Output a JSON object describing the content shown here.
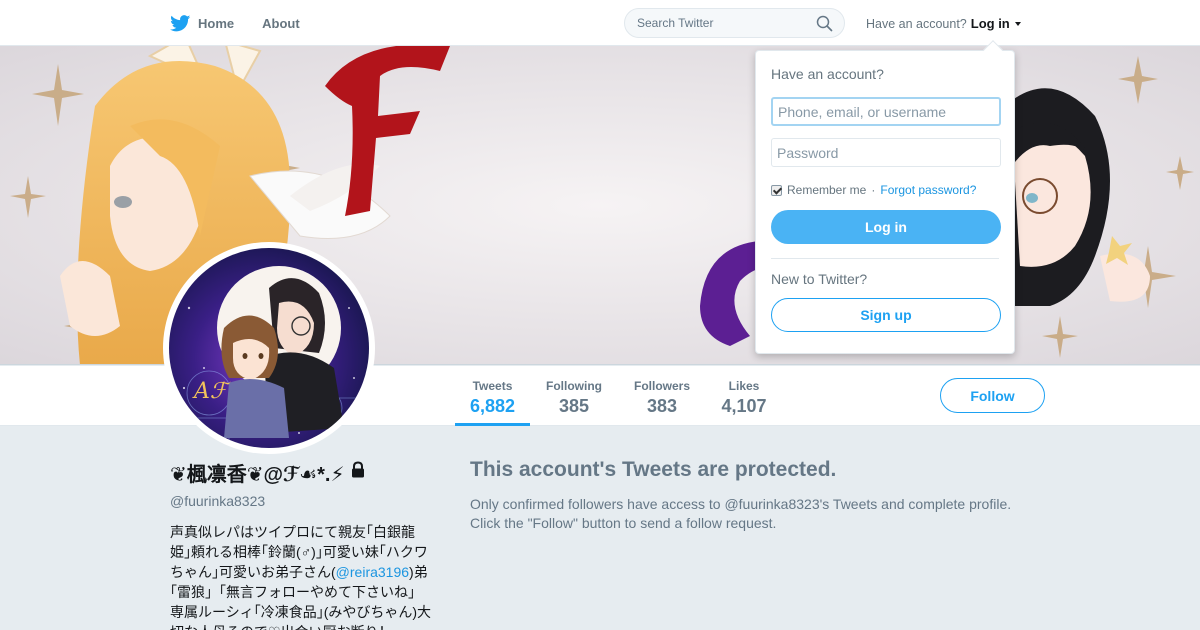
{
  "nav": {
    "home_label": "Home",
    "about_label": "About"
  },
  "search": {
    "placeholder": "Search Twitter"
  },
  "account_prompt": "Have an account?",
  "login_label": "Log in",
  "profile_nav": {
    "tweets_label": "Tweets",
    "tweets_value": "6,882",
    "following_label": "Following",
    "following_value": "385",
    "followers_label": "Followers",
    "followers_value": "383",
    "likes_label": "Likes",
    "likes_value": "4,107",
    "follow_label": "Follow"
  },
  "profile": {
    "name": "❦楓凛香❦@ℱ☙*.⚡",
    "handle": "@fuurinka8323",
    "bio_part1": "声真似レパはツイプロにて親友｢白銀龍姫｣頼れる相棒｢鈴蘭(♂)｣可愛い妹｢ハクワちゃん｣可愛いお弟子さん(",
    "bio_mention": "@reira3196",
    "bio_part2": ")弟｢雷狼｣「無言フォローやめて下さいね」専属ルーシィ｢冷凍食品｣(みやびちゃん)大切な人母るので♡出会い厨お断り！"
  },
  "protected": {
    "title": "This account's Tweets are protected.",
    "line1": "Only confirmed followers have access to @fuurinka8323's Tweets and complete profile.",
    "line2": "Click the \"Follow\" button to send a follow request."
  },
  "login_dropdown": {
    "title": "Have an account?",
    "username_placeholder": "Phone, email, or username",
    "password_placeholder": "Password",
    "remember_label": "Remember me",
    "separator": "·",
    "forgot_label": "Forgot password?",
    "login_button": "Log in",
    "new_label": "New to Twitter?",
    "signup_button": "Sign up"
  },
  "colors": {
    "accent": "#1da1f2",
    "login_button": "#4ab3f4",
    "muted": "#657786",
    "background": "#e6ecf0"
  },
  "icons": [
    "twitter-bird-icon",
    "magnifier-icon",
    "caret-down-icon",
    "lock-icon",
    "checkbox-icon"
  ]
}
